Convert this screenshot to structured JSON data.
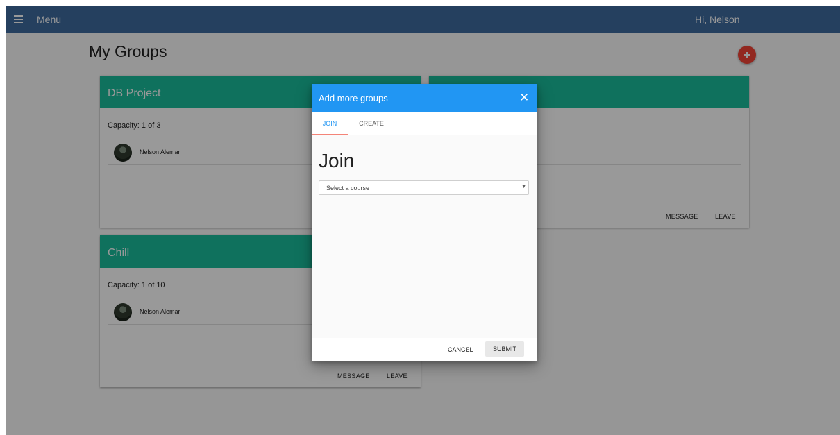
{
  "topbar": {
    "menu_icon": "hamburger-icon",
    "menu_label": "Menu",
    "greeting": "Hi, Nelson"
  },
  "page": {
    "title": "My Groups",
    "add_icon": "plus-icon"
  },
  "groups": [
    {
      "name": "DB Project",
      "capacity": "Capacity: 1 of 3",
      "members": [
        "Nelson Alemar"
      ]
    },
    {
      "name": "",
      "capacity": "",
      "members": [],
      "actions": [
        "MESSAGE",
        "LEAVE"
      ]
    },
    {
      "name": "Chill",
      "capacity": "Capacity: 1 of 10",
      "members": [
        "Nelson Alemar"
      ],
      "actions": [
        "MESSAGE",
        "LEAVE"
      ]
    }
  ],
  "dialog": {
    "title": "Add more groups",
    "close_icon": "close-icon",
    "tabs": [
      "JOIN",
      "CREATE"
    ],
    "active_tab": "JOIN",
    "heading": "Join",
    "course_select": {
      "selected": "Select a course",
      "arrow_icon": "caret-down-icon"
    },
    "cancel_label": "CANCEL",
    "submit_label": "SUBMIT"
  },
  "colors": {
    "topbar": "#3f6b9f",
    "card_header": "#1abc9c",
    "dialog_header": "#2196f3",
    "fab": "#f44336",
    "tab_indicator": "#f48478"
  }
}
